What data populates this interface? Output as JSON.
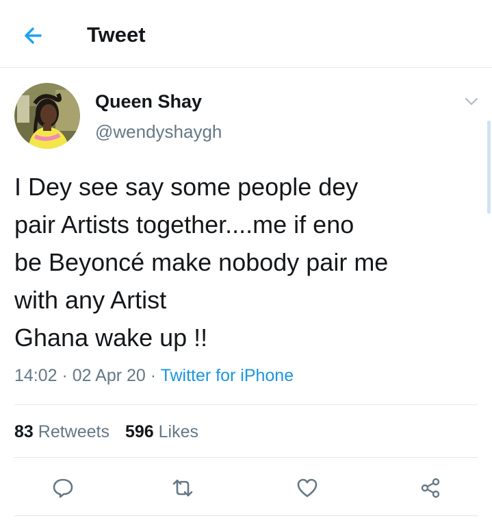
{
  "header": {
    "title": "Tweet",
    "back_icon": "arrow-left-icon"
  },
  "colors": {
    "accent": "#1da1f2",
    "link": "#1b95e0",
    "text_primary": "#14171a",
    "text_secondary": "#657786",
    "divider": "#e1e8ed"
  },
  "user": {
    "display_name": "Queen Shay",
    "handle": "@wendyshaygh"
  },
  "tweet": {
    "lines": [
      "I Dey see say some people dey",
      "pair Artists together....me if eno",
      "be Beyoncé make nobody pair me",
      "with any Artist",
      "Ghana wake up !!"
    ],
    "time": "14:02",
    "separator": " · ",
    "date": "02 Apr 20",
    "source": "Twitter for iPhone"
  },
  "stats": {
    "retweets_count": "83",
    "retweets_label": "Retweets",
    "likes_count": "596",
    "likes_label": "Likes"
  },
  "actions": {
    "reply_icon": "reply-icon",
    "retweet_icon": "retweet-icon",
    "like_icon": "heart-icon",
    "share_icon": "share-icon"
  }
}
